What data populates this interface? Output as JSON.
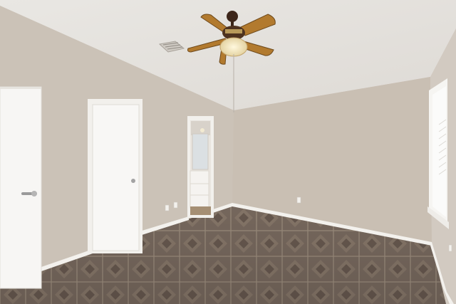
{
  "image": {
    "kind": "photograph",
    "subject": "empty-bedroom-interior"
  },
  "colors": {
    "ceiling": "#ebe9e5",
    "ceiling_shadow": "#dcd9d4",
    "wall_left": "#cbc1b6",
    "wall_back": "#c8bdb1",
    "wall_right": "#d3cbc2",
    "trim": "#f4f2ef",
    "door": "#f7f6f4",
    "floor_tile": "#7d6e63",
    "floor_grout": "#a89a8c",
    "fan_blade": "#b27a2e",
    "fan_motor": "#4a2e1c",
    "fan_light": "#f2e4b8"
  },
  "icons": [
    "ceiling-fan",
    "air-vent",
    "door-knob",
    "electrical-outlet",
    "light-switch"
  ]
}
